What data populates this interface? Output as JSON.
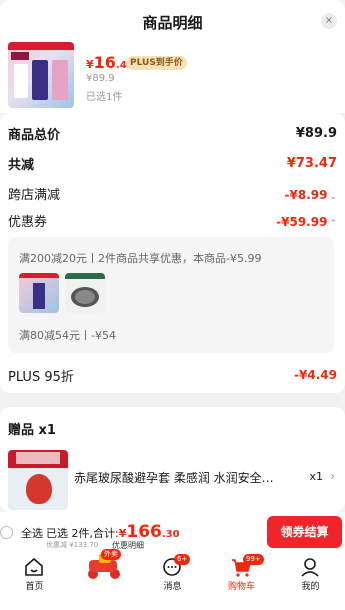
{
  "header": {
    "title": "商品明细",
    "close": "×"
  },
  "product": {
    "price_symbol": "¥",
    "price_int": "16",
    "price_dec": ".43",
    "plus_badge": "PLUS到手价",
    "original_price": "¥89.9",
    "selected": "已选1件"
  },
  "breakdown": {
    "total_label": "商品总价",
    "total_value": "¥89.9",
    "reduce_label": "共减",
    "reduce_value": "¥73.47",
    "cross_store_label": "跨店满减",
    "cross_store_value": "-¥8.99",
    "coupon_label": "优惠券",
    "coupon_value": "-¥59.99",
    "coupon_detail_1": "满200减20元丨2件商品共享优惠，本商品-¥5.99",
    "coupon_detail_2": "满80减54元丨-¥54",
    "plus_label": "PLUS 95折",
    "plus_value": "-¥4.49"
  },
  "gift": {
    "title": "赠品 x1",
    "name": "赤尾玻尿酸避孕套 柔感润 水润安全套...",
    "qty": "x1"
  },
  "bottom": {
    "select_all": "全选",
    "selected_count": "已选 2件,合计:",
    "total_symbol": "¥",
    "total_int": "166",
    "total_dec": ".30",
    "saved": "优惠减 ¥133.70",
    "detail_link": "优惠明细",
    "checkout": "领券结算"
  },
  "tabs": [
    {
      "label": "首页",
      "icon": "home-icon"
    },
    {
      "label": "",
      "icon": "takeout-icon",
      "badge": "外卖"
    },
    {
      "label": "消息",
      "icon": "message-icon",
      "badge": "6+"
    },
    {
      "label": "购物车",
      "icon": "cart-icon",
      "badge": "99+"
    },
    {
      "label": "我的",
      "icon": "profile-icon"
    }
  ],
  "colors": {
    "accent": "#f2270c",
    "plus_gold": "#f6e2b8",
    "checkout": "#f0252c"
  }
}
